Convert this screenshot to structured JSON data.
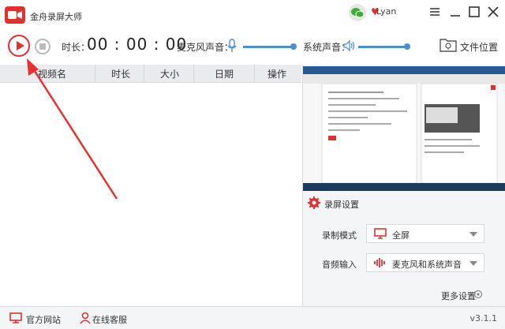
{
  "app": {
    "title": "金舟录屏大师",
    "user": "Lyan",
    "brand_color": "#e03131"
  },
  "toolbar": {
    "duration_label": "时长：",
    "timer": "00 : 00 : 00",
    "mic_label": "麦克风声音：",
    "system_label": "系统声音：",
    "folder_label": "文件位置",
    "mic_level": 1.0,
    "system_level": 1.0
  },
  "list": {
    "columns": [
      "视频名",
      "时长",
      "大小",
      "日期",
      "操作"
    ]
  },
  "settings": {
    "title": "录屏设置",
    "mode_label": "录制模式",
    "mode_value": "全屏",
    "audio_label": "音频输入",
    "audio_value": "麦克风和系统声音",
    "more": "更多设置"
  },
  "footer": {
    "website": "官方网站",
    "support": "在线客服",
    "version": "v3.1.1"
  }
}
